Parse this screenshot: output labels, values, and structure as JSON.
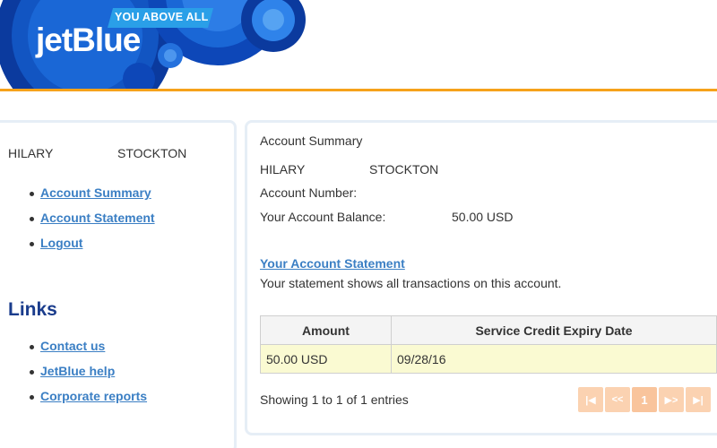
{
  "brand": {
    "logo": "jetBlue",
    "tagline": "YOU ABOVE ALL",
    "accent_color": "#f6a21a",
    "primary_color": "#0d3fa0"
  },
  "sidebar": {
    "user_first": "HILARY",
    "user_last": "STOCKTON",
    "nav": [
      {
        "label": "Account Summary"
      },
      {
        "label": "Account Statement"
      },
      {
        "label": "Logout"
      }
    ],
    "links_title": "Links",
    "links": [
      {
        "label": "Contact us"
      },
      {
        "label": "JetBlue help"
      },
      {
        "label": "Corporate reports"
      }
    ]
  },
  "main": {
    "title": "Account Summary",
    "first_name": "HILARY",
    "last_name": "STOCKTON",
    "account_number_label": "Account Number:",
    "balance_label": "Your Account Balance:",
    "balance_value": "50.00 USD",
    "statement_link": "Your Account Statement",
    "statement_desc": "Your statement shows all transactions on this account.",
    "table": {
      "headers": [
        "Amount",
        "Service Credit Expiry Date"
      ],
      "rows": [
        [
          "50.00 USD",
          "09/28/16"
        ]
      ]
    },
    "showing": "Showing 1 to 1 of 1 entries",
    "pager": {
      "first": "first-page-icon",
      "prev": "previous-page-icon",
      "current": "1",
      "next": "next-page-icon",
      "last": "last-page-icon"
    }
  }
}
